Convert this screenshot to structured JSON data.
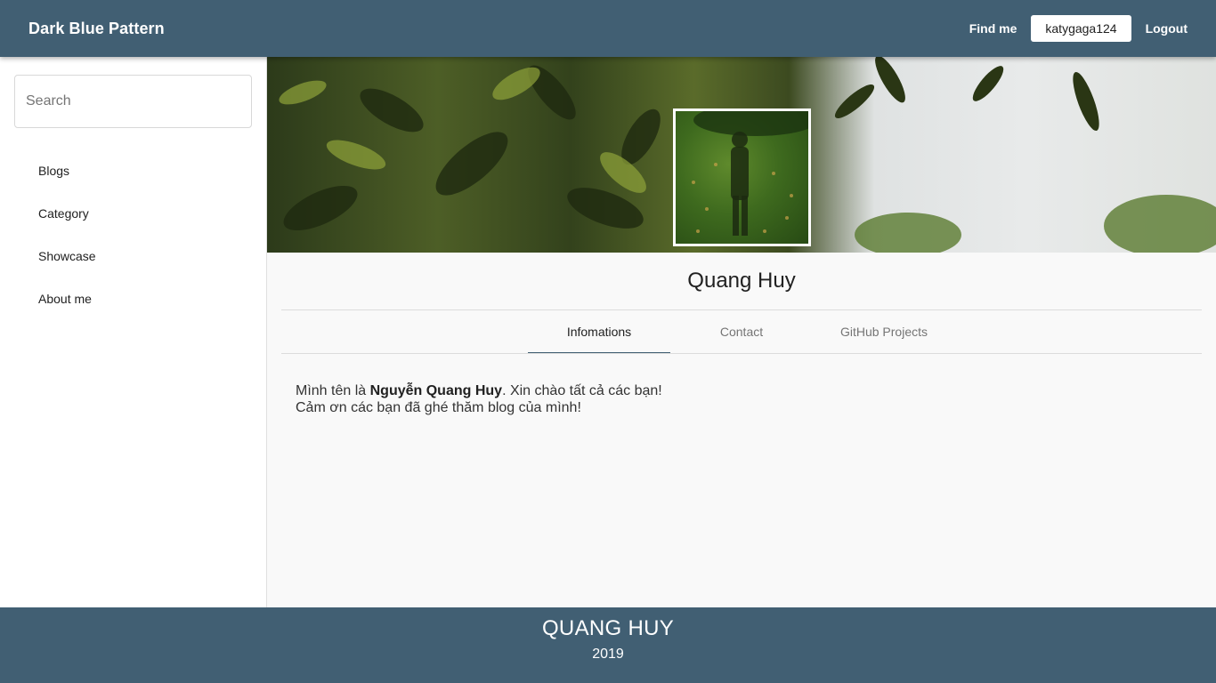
{
  "header": {
    "brand": "Dark Blue Pattern",
    "find_me": "Find me",
    "username": "katygaga124",
    "logout": "Logout"
  },
  "sidebar": {
    "search_placeholder": "Search",
    "items": [
      {
        "label": "Blogs"
      },
      {
        "label": "Category"
      },
      {
        "label": "Showcase"
      },
      {
        "label": "About me"
      }
    ]
  },
  "profile": {
    "name": "Quang Huy",
    "tabs": [
      {
        "label": "Infomations",
        "active": true
      },
      {
        "label": "Contact",
        "active": false
      },
      {
        "label": "GitHub Projects",
        "active": false
      }
    ],
    "info": {
      "line1_prefix": "Mình tên là ",
      "line1_bold": "Nguyễn Quang Huy",
      "line1_suffix": ". Xin chào tất cả các bạn!",
      "line2": "Cảm ơn các bạn đã ghé thăm blog của mình!"
    }
  },
  "footer": {
    "title": "QUANG HUY",
    "year": "2019"
  },
  "colors": {
    "primary": "#415f73",
    "background": "#f9f9f9"
  }
}
